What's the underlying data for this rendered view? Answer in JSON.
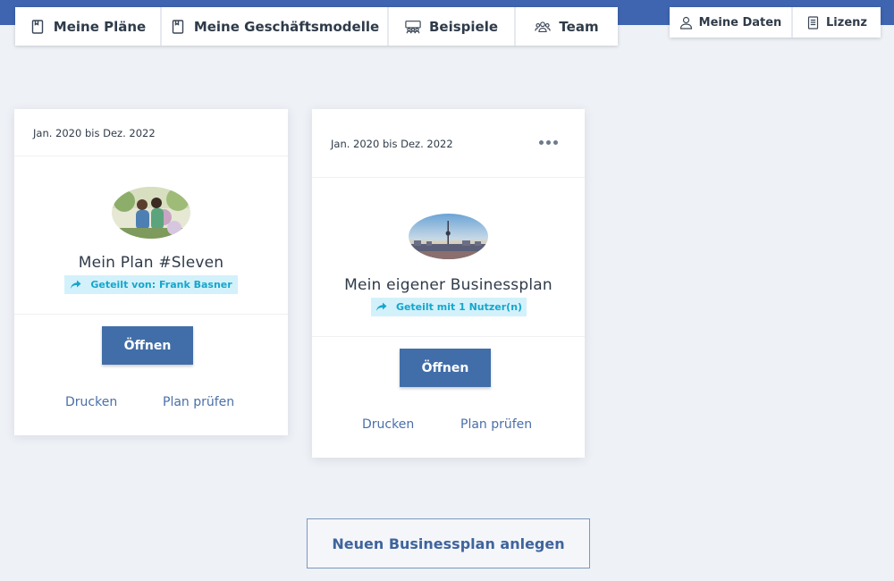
{
  "nav": {
    "items": [
      {
        "label": "Meine Pläne",
        "icon": "plan-book-icon"
      },
      {
        "label": "Meine Geschäftsmodelle",
        "icon": "business-model-icon"
      },
      {
        "label": "Beispiele",
        "icon": "examples-icon"
      },
      {
        "label": "Team",
        "icon": "team-icon"
      }
    ]
  },
  "usernav": {
    "items": [
      {
        "label": "Meine Daten",
        "icon": "user-icon"
      },
      {
        "label": "Lizenz",
        "icon": "license-icon"
      }
    ]
  },
  "cards": [
    {
      "date_range": "Jan. 2020 bis Dez. 2022",
      "title": "Mein Plan #Sleven",
      "share_text": "Geteilt von: Frank Basner",
      "open_label": "Öffnen",
      "print_label": "Drucken",
      "check_label": "Plan prüfen"
    },
    {
      "date_range": "Jan. 2020 bis Dez. 2022",
      "title": "Mein eigener Businessplan",
      "share_text": "Geteilt mit 1 Nutzer(n)",
      "open_label": "Öffnen",
      "print_label": "Drucken",
      "check_label": "Plan prüfen"
    }
  ],
  "new_plan_label": "Neuen Businessplan anlegen",
  "colors": {
    "brand_blue": "#3f64b0",
    "button_blue": "#416ea9",
    "share_bg": "#d3f1fa",
    "share_text": "#16a6cc",
    "background": "#eef1f6"
  }
}
